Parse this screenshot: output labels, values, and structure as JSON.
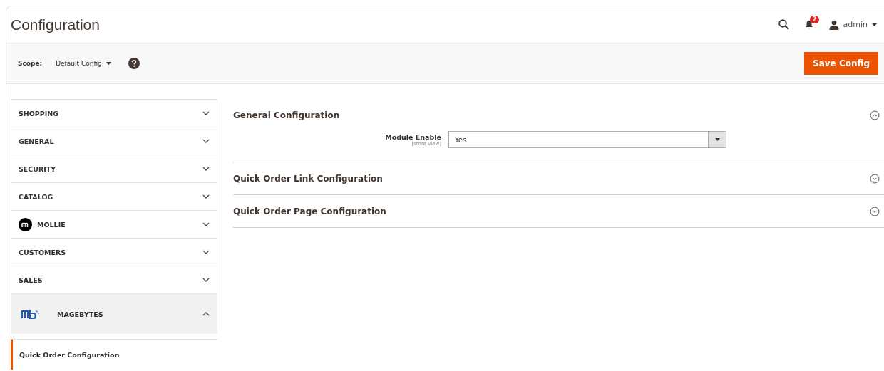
{
  "header": {
    "title": "Configuration",
    "notifications": "2",
    "user": "admin"
  },
  "toolbar": {
    "scope_label": "Scope:",
    "scope_value": "Default Config",
    "save_button": "Save Config"
  },
  "sidebar": {
    "items": [
      {
        "label": "SHOPPING",
        "kind": "plain",
        "expanded": false
      },
      {
        "label": "GENERAL",
        "kind": "plain",
        "expanded": false
      },
      {
        "label": "SECURITY",
        "kind": "plain",
        "expanded": false
      },
      {
        "label": "CATALOG",
        "kind": "plain",
        "expanded": false
      },
      {
        "label": "MOLLIE",
        "kind": "mollie",
        "expanded": false
      },
      {
        "label": "CUSTOMERS",
        "kind": "plain",
        "expanded": false
      },
      {
        "label": "SALES",
        "kind": "plain",
        "expanded": false
      },
      {
        "label": "MAGEBYTES",
        "kind": "magebytes",
        "expanded": true,
        "children": [
          {
            "label": "Quick Order Configuration",
            "selected": true
          }
        ]
      }
    ]
  },
  "sections": [
    {
      "title": "General Configuration",
      "expanded": true,
      "fields": [
        {
          "label": "Module Enable",
          "scope": "[store view]",
          "value": "Yes"
        }
      ]
    },
    {
      "title": "Quick Order Link Configuration",
      "expanded": false
    },
    {
      "title": "Quick Order Page Configuration",
      "expanded": false
    }
  ]
}
